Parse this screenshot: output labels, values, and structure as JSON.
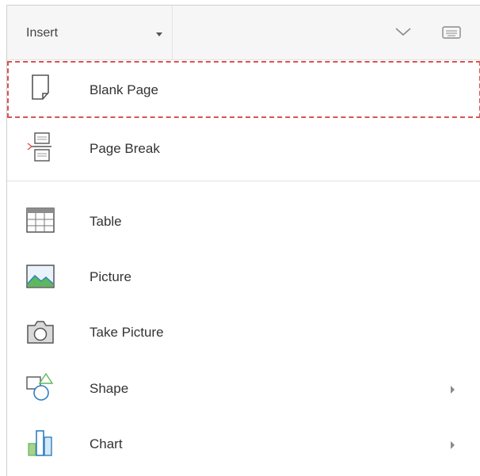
{
  "header": {
    "tab_label": "Insert"
  },
  "menu": {
    "items": [
      {
        "label": "Blank Page",
        "icon": "blank-page-icon"
      },
      {
        "label": "Page Break",
        "icon": "page-break-icon"
      },
      {
        "label": "Table",
        "icon": "table-icon"
      },
      {
        "label": "Picture",
        "icon": "picture-icon"
      },
      {
        "label": "Take Picture",
        "icon": "camera-icon"
      },
      {
        "label": "Shape",
        "icon": "shape-icon"
      },
      {
        "label": "Chart",
        "icon": "chart-icon"
      }
    ]
  },
  "colors": {
    "selection_outline": "#d9534f",
    "header_bg": "#f6f6f6",
    "accent_blue": "#2f7fc1",
    "accent_green": "#5cb85c"
  }
}
